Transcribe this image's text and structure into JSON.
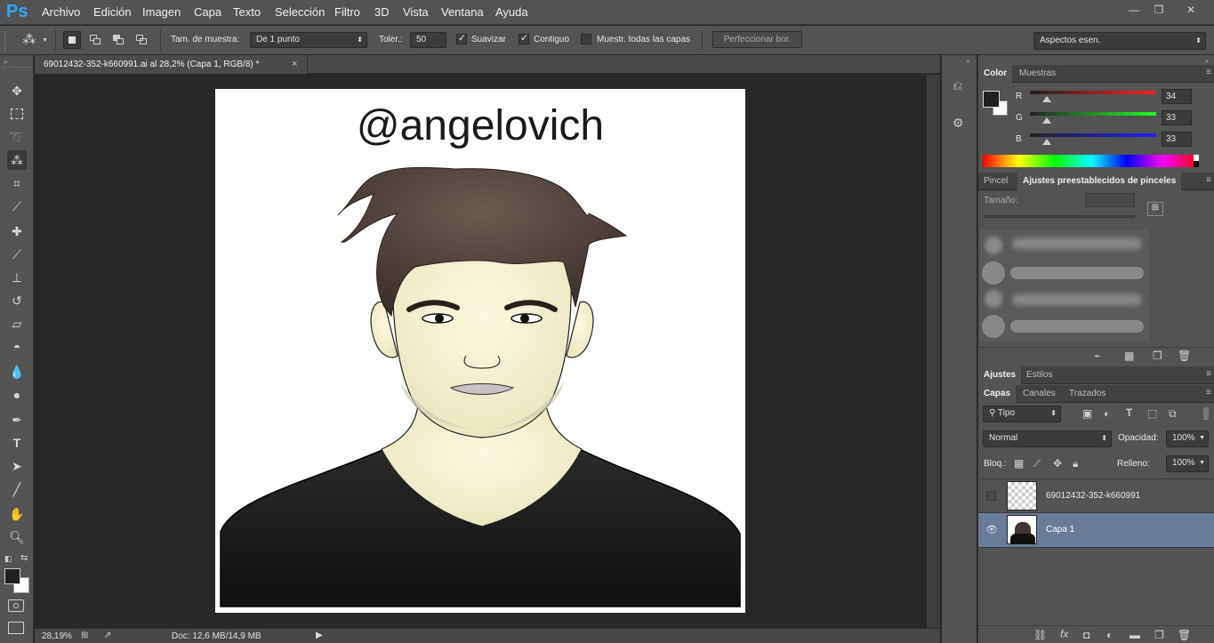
{
  "app": {
    "logo": "Ps"
  },
  "menu": [
    "Archivo",
    "Edición",
    "Imagen",
    "Capa",
    "Texto",
    "Selección",
    "Filtro",
    "3D",
    "Vista",
    "Ventana",
    "Ayuda"
  ],
  "window_controls": {
    "minimize": "—",
    "restore": "❐",
    "close": "✕"
  },
  "options_bar": {
    "sample_size_label": "Tam. de muestra:",
    "sample_size_value": "De 1 punto",
    "tolerance_label": "Toler.:",
    "tolerance_value": "50",
    "antialias_label": "Suavizar",
    "antialias_checked": true,
    "contiguous_label": "Contiguo",
    "contiguous_checked": true,
    "sample_all_label": "Muestr. todas las capas",
    "sample_all_checked": false,
    "refine_edge_label": "Perfeccionar bor.",
    "workspace_value": "Aspectos esen."
  },
  "document": {
    "tab_title": "69012432-352-k660991.ai al 28,2% (Capa 1, RGB/8) *",
    "close_glyph": "×",
    "artwork_text": "@angelovich",
    "zoom": "28,19%",
    "doc_info": "Doc: 12,6 MB/14,9 MB"
  },
  "color_panel": {
    "tabs": [
      "Color",
      "Muestras"
    ],
    "r_label": "R",
    "r_value": "34",
    "g_label": "G",
    "g_value": "33",
    "b_label": "B",
    "b_value": "33",
    "r_level": 0.13,
    "g_level": 0.13,
    "b_level": 0.13,
    "foreground": "#222121",
    "background": "#ffffff"
  },
  "brush_panel": {
    "tabs": [
      "Pincel",
      "Ajustes preestablecidos de pinceles"
    ],
    "size_label": "Tamaño:"
  },
  "adjust_panel": {
    "tabs": [
      "Ajustes",
      "Estilos"
    ]
  },
  "layers_panel": {
    "tabs": [
      "Capas",
      "Canales",
      "Trazados"
    ],
    "filter_value": "Tipo",
    "blend_mode": "Normal",
    "opacity_label": "Opacidad:",
    "opacity_value": "100%",
    "lock_label": "Bloq.:",
    "fill_label": "Relleno:",
    "fill_value": "100%",
    "layers": [
      {
        "name": "69012432-352-k660991",
        "visible": false,
        "selected": false
      },
      {
        "name": "Capa 1",
        "visible": true,
        "selected": true
      }
    ]
  },
  "colors": {
    "accent_selected_layer": "#687b98",
    "panel_bg": "#535353",
    "canvas_bg": "#282828"
  }
}
